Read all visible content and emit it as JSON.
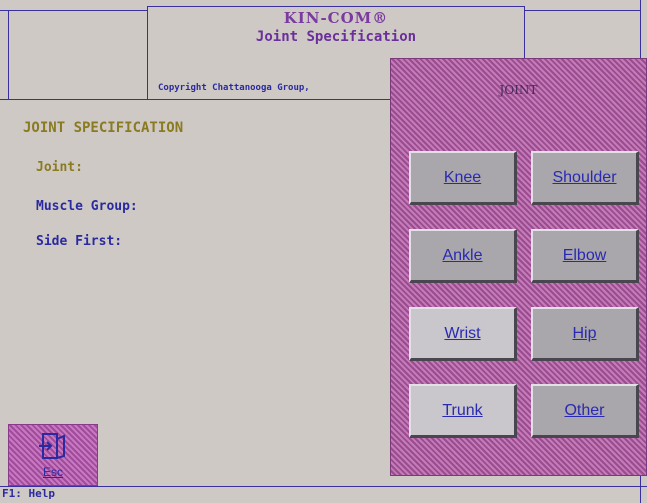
{
  "header": {
    "app_name": "KIN-COM®",
    "screen_title": "Joint Specification",
    "copyright": "Copyright Chattanooga Group,"
  },
  "form": {
    "section_title": "JOINT SPECIFICATION",
    "joint_label": "Joint:",
    "muscle_group_label": "Muscle Group:",
    "side_first_label": "Side First:"
  },
  "footer": {
    "esc_label": "Esc",
    "help_text": "F1: Help"
  },
  "dialog": {
    "title": "JOINT",
    "buttons": [
      "Knee",
      "Shoulder",
      "Ankle",
      "Elbow",
      "Wrist",
      "Hip",
      "Trunk",
      "Other"
    ]
  },
  "colors": {
    "background": "#cfc9c6",
    "panel_pattern": "#a14b9c",
    "text_blue": "#2a2aa0",
    "text_olive": "#8a7a20"
  }
}
